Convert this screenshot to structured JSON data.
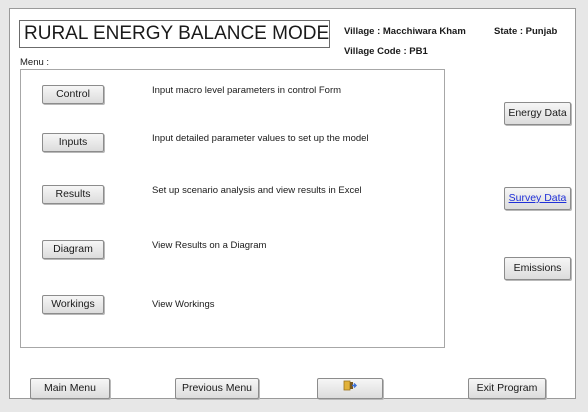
{
  "header": {
    "title": "RURAL ENERGY BALANCE MODEL",
    "village": "Village : Macchiwara Kham",
    "state": "State : Punjab",
    "village_code": "Village Code : PB1"
  },
  "menu": {
    "label": "Menu :",
    "items": [
      {
        "button": "Control",
        "description": "Input macro level parameters in control Form"
      },
      {
        "button": "Inputs",
        "description": "Input detailed parameter values to set up the model"
      },
      {
        "button": "Results",
        "description": "Set up scenario analysis and view results in Excel"
      },
      {
        "button": "Diagram",
        "description": "View Results on a Diagram"
      },
      {
        "button": "Workings",
        "description": "View Workings"
      }
    ]
  },
  "side_buttons": {
    "energy_data": "Energy Data",
    "survey_data": "Survey Data",
    "emissions": "Emissions"
  },
  "bottom_bar": {
    "main_menu": "Main Menu",
    "previous_menu": "Previous Menu",
    "icon_button": "door-exit-icon",
    "exit_program": "Exit Program"
  },
  "colors": {
    "link": "#1f2fd8",
    "icon_yellow": "#e2b23a",
    "icon_blue": "#3b6fd6"
  }
}
